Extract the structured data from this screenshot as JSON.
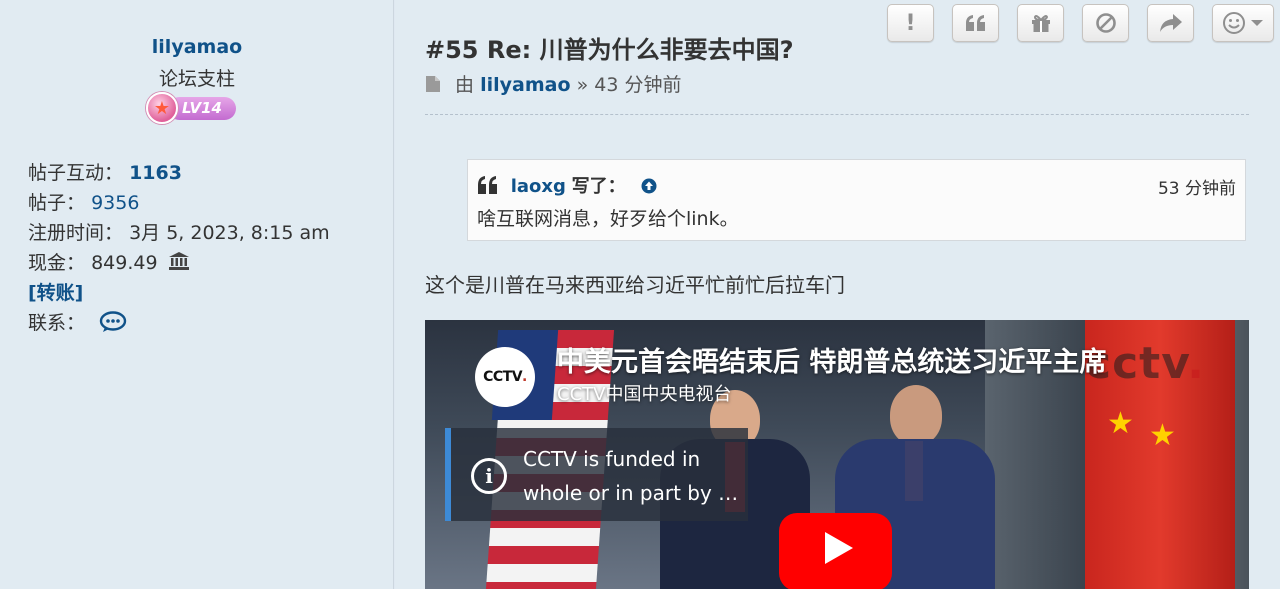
{
  "profile": {
    "username": "lilyamao",
    "rank": "论坛支柱",
    "level_badge": "LV14",
    "interactions_label": "帖子互动：",
    "interactions_value": "1163",
    "posts_label": "帖子：",
    "posts_value": "9356",
    "registered_label": "注册时间：",
    "registered_value": "3月 5, 2023, 8:15 am",
    "cash_label": "现金：",
    "cash_value": "849.49",
    "transfer_link": "[转账]",
    "contact_label": "联系："
  },
  "toolbar": {
    "buttons": [
      {
        "name": "report-button",
        "glyph": "!"
      },
      {
        "name": "quote-button",
        "glyph": "❝"
      },
      {
        "name": "gift-button",
        "glyph": "gift"
      },
      {
        "name": "block-button",
        "glyph": "⊘"
      },
      {
        "name": "share-button",
        "glyph": "↪"
      },
      {
        "name": "reaction-button",
        "glyph": "☺▾"
      }
    ]
  },
  "post": {
    "title": "#55 Re: 川普为什么非要去中国?",
    "by_label": "由",
    "author": "lilyamao",
    "separator": "»",
    "time": "43 分钟前",
    "body": "这个是川普在马来西亚给习近平忙前忙后拉车门"
  },
  "quote": {
    "author": "laoxg",
    "wrote_label": "写了：",
    "time": "53 分钟前",
    "text": "啥互联网消息，好歹给个link。"
  },
  "video": {
    "title": "中美元首会晤结束后 特朗普总统送习近平主席",
    "channel": "CCTV中国中央电视台",
    "logo_text": "CCTV",
    "info_text": "CCTV is funded in whole or in part by …",
    "watermark": "cctv"
  },
  "colors": {
    "link": "#105289",
    "background": "#e1ebf2",
    "play_button": "#ff0000",
    "info_bar": "#3d8ad6"
  }
}
